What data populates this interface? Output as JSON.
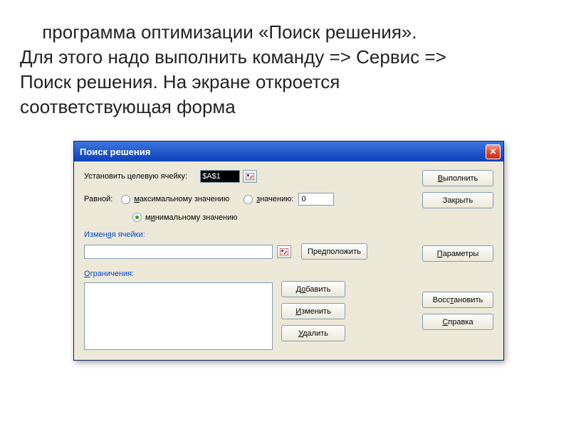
{
  "slide": {
    "paragraph": " программа оптимизации «Поиск решения». Для этого надо выполнить команду => Сервис => Поиск решения. На экране откроется соответствующая форма"
  },
  "dialog": {
    "title": "Поиск решения",
    "target_label": "Установить целевую ячейку:",
    "target_value": "$A$1",
    "equal_label": "Равной:",
    "radio_max": "максимальному значению",
    "radio_val": "значению:",
    "radio_min": "минимальному значению",
    "value_input": "0",
    "changing_label": "Изменяя ячейки:",
    "changing_value": "",
    "btn_assume": "Предположить",
    "constraints_label": "Ограничения:",
    "btn_add": "Добавить",
    "btn_change": "Изменить",
    "btn_delete": "Удалить",
    "btn_execute": "Выполнить",
    "btn_close": "Закрыть",
    "btn_params": "Параметры",
    "btn_restore": "Восстановить",
    "btn_help": "Справка"
  }
}
